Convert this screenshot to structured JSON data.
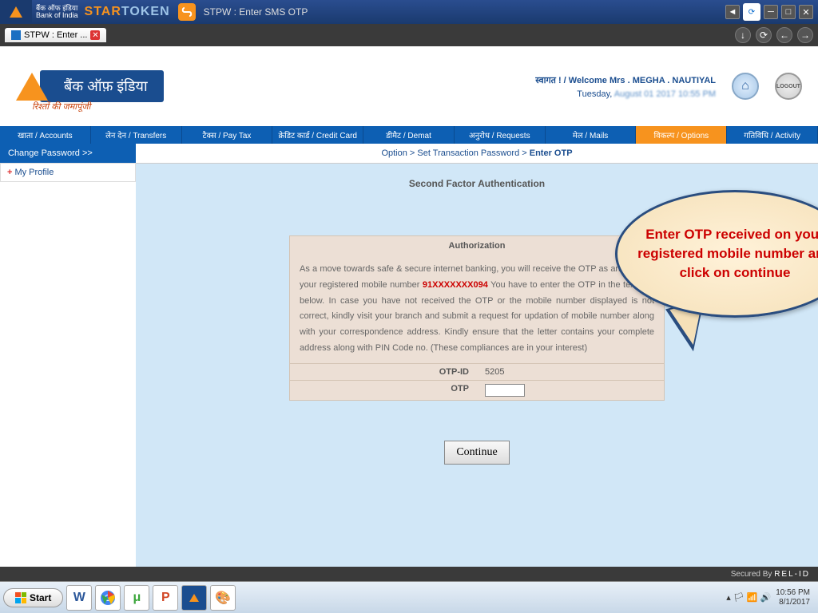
{
  "titlebar": {
    "brand_line1": "बैंक ऑफ इंडिया",
    "brand_line2": "Bank of India",
    "product": "STARTOKEN",
    "title": "STPW : Enter SMS OTP"
  },
  "tab": {
    "label": "STPW : Enter ..."
  },
  "header": {
    "bank_name": "बैंक ऑफ़ इंडिया",
    "tagline": "रिश्तों की जमापूंजी",
    "welcome_prefix": "स्वागत ! / Welcome Mrs . ",
    "welcome_name": "MEGHA . NAUTIYAL",
    "date_prefix": "Tuesday, ",
    "date_rest": "August 01 2017 10:55 PM",
    "logout_label": "LOGOUT"
  },
  "nav": {
    "items": [
      "खाता / Accounts",
      "लेन देन / Transfers",
      "टैक्स / Pay Tax",
      "क्रेडिट कार्ड / Credit Card",
      "डीमैट / Demat",
      "अनुरोध / Requests",
      "मेल / Mails",
      "विकल्प / Options",
      "गतिविधि / Activity"
    ],
    "active_index": 7
  },
  "sidebar": {
    "header": "Change Password >>",
    "item1": "My Profile"
  },
  "breadcrumb": {
    "p1": "Option",
    "p2": "Set Transaction Password",
    "p3": "Enter OTP"
  },
  "main": {
    "section_title": "Second Factor Authentication",
    "auth_header": "Authorization",
    "body_pre": "As a move towards safe & secure internet banking, you will receive the OTP as an SMS on your registered mobile number ",
    "masked_number": "91XXXXXXX094",
    "body_post": " You have to enter the OTP in the text box below. In case you have not received the OTP or the mobile number displayed is not correct, kindly visit your branch and submit a request for updation of mobile number along with your correspondence address. Kindly ensure that the letter contains your complete address along with PIN Code no. (These compliances are in your interest)",
    "otp_id_label": "OTP-ID",
    "otp_id_value": "5205",
    "otp_label": "OTP",
    "continue_label": "Continue"
  },
  "callout": {
    "text": "Enter OTP received on your registered mobile number and click on continue"
  },
  "footer": {
    "secured_by": "Secured By ",
    "brand": "REL-ID"
  },
  "taskbar": {
    "start": "Start",
    "time": "10:56 PM",
    "date": "8/1/2017"
  }
}
